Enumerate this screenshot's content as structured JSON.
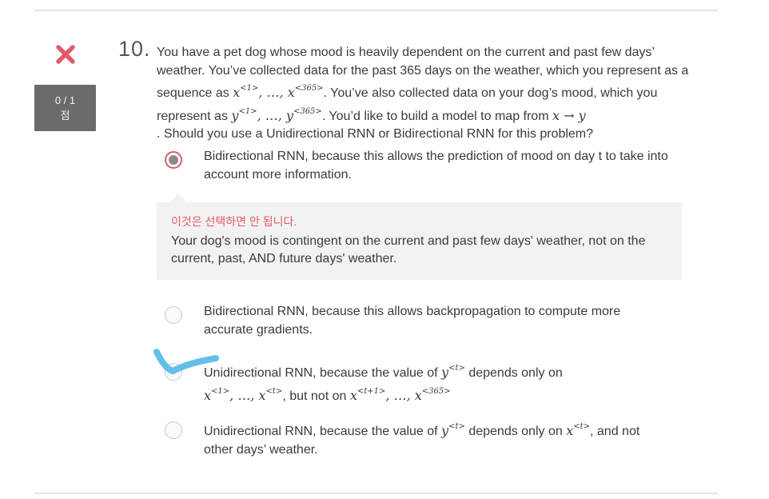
{
  "question": {
    "number": "10.",
    "status_icon": "close-icon",
    "score": "0 / 1",
    "score_unit": "점",
    "text": {
      "p1": "You have a pet dog whose mood is heavily dependent on the current and past few days’ weather. You’ve collected data for the past 365 days on the weather, which you represent as a sequence as ",
      "seq_x": "x<1>, …, x<365>",
      "p2": ". You’ve also collected data on your dog’s mood, which you represent as ",
      "seq_y": "y<1>, …, y<365>",
      "p3": ". You’d like to build a model to map from ",
      "map": "x → y",
      "p4": ". Should you use a Unidirectional RNN or Bidirectional RNN for this problem?"
    }
  },
  "options": [
    {
      "label": "Bidirectional RNN, because this allows the prediction of mood on day t to take into account more information.",
      "selected": true,
      "correct": false
    },
    {
      "label": "Bidirectional RNN, because this allows backpropagation to compute more accurate gradients.",
      "selected": false
    },
    {
      "p1": "Unidirectional RNN, because the value of ",
      "m1": "y<t>",
      "p2": " depends only on ",
      "m2": "x<1>, …, x<t>",
      "p3": ", but not on ",
      "m3": "x<t+1>, …, x<365>",
      "selected": false,
      "annotation": "check-mark"
    },
    {
      "p1": "Unidirectional RNN, because the value of ",
      "m1": "y<t>",
      "p2": " depends only on ",
      "m2": "x<t>",
      "p3": ", and not other days’ weather.",
      "selected": false
    }
  ],
  "feedback": {
    "title": "이것은 선택하면 안 됩니다.",
    "body": "Your dog's mood is contingent on the current and past few days' weather, not on the current, past, AND future days' weather."
  },
  "colors": {
    "wrong": "#e15a6a",
    "score_bg": "#6b6b6b",
    "feedback_bg": "#f2f2f2",
    "annotation": "#5bbde8"
  }
}
